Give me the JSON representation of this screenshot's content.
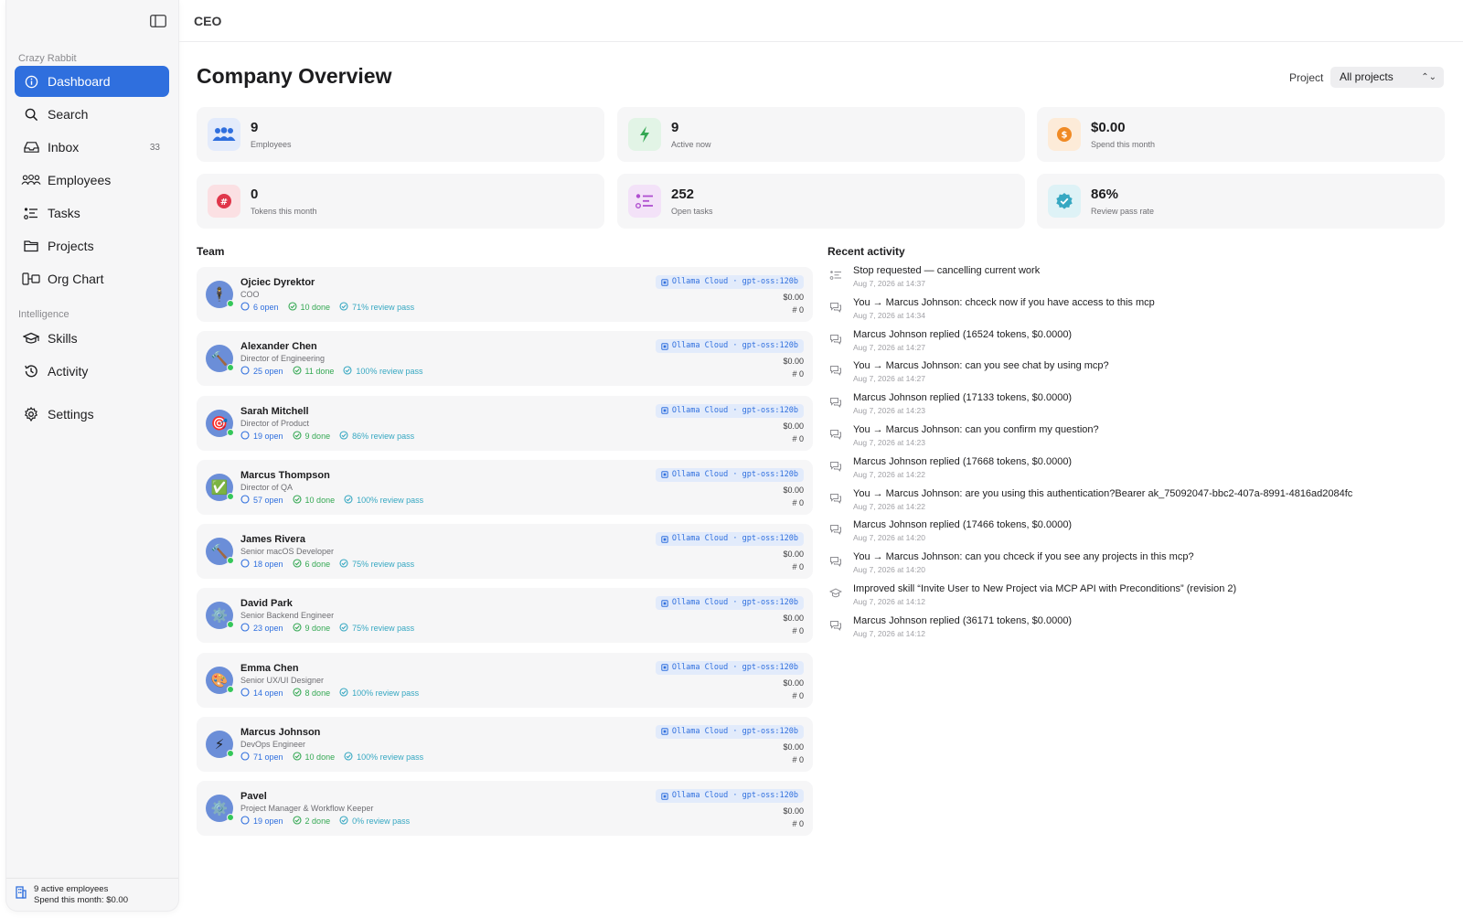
{
  "topbar": {
    "title": "CEO"
  },
  "sidebar": {
    "workspace": "Crazy Rabbit",
    "intelligence_label": "Intelligence",
    "items": [
      {
        "label": "Dashboard",
        "icon": "dashboard-icon"
      },
      {
        "label": "Search",
        "icon": "search-icon"
      },
      {
        "label": "Inbox",
        "icon": "inbox-icon",
        "count": "33"
      },
      {
        "label": "Employees",
        "icon": "people-icon"
      },
      {
        "label": "Tasks",
        "icon": "tasks-icon"
      },
      {
        "label": "Projects",
        "icon": "folder-icon"
      },
      {
        "label": "Org Chart",
        "icon": "org-chart-icon"
      },
      {
        "label": "Skills",
        "icon": "skills-icon"
      },
      {
        "label": "Activity",
        "icon": "clock-icon"
      },
      {
        "label": "Settings",
        "icon": "gear-icon"
      }
    ],
    "footer": {
      "line1": "9 active employees",
      "line2": "Spend this month: $0.00"
    }
  },
  "main": {
    "title": "Company Overview",
    "project_label": "Project",
    "project_value": "All projects",
    "team_heading": "Team",
    "activity_heading": "Recent activity"
  },
  "stats": [
    {
      "value": "9",
      "label": "Employees",
      "color": "#2f6fde",
      "bg": "#e3ebfb"
    },
    {
      "value": "9",
      "label": "Active now",
      "color": "#34a853",
      "bg": "#e2f4e6"
    },
    {
      "value": "$0.00",
      "label": "Spend this month",
      "color": "#f08a24",
      "bg": "#fdebd8"
    },
    {
      "value": "0",
      "label": "Tokens this month",
      "color": "#e0364a",
      "bg": "#fbe0e3"
    },
    {
      "value": "252",
      "label": "Open tasks",
      "color": "#b04fd0",
      "bg": "#f3e2f8"
    },
    {
      "value": "86%",
      "label": "Review pass rate",
      "color": "#37a8c2",
      "bg": "#def2f6"
    }
  ],
  "team": [
    {
      "name": "Ojciec Dyrektor",
      "role": "COO",
      "open": "6 open",
      "done": "10 done",
      "pass": "71% review pass",
      "model": "Ollama Cloud · gpt-oss:120b",
      "cost": "$0.00",
      "tokens": "#  0",
      "emoji": "🕴️"
    },
    {
      "name": "Alexander Chen",
      "role": "Director of Engineering",
      "open": "25 open",
      "done": "11 done",
      "pass": "100% review pass",
      "model": "Ollama Cloud · gpt-oss:120b",
      "cost": "$0.00",
      "tokens": "#  0",
      "emoji": "🔨"
    },
    {
      "name": "Sarah Mitchell",
      "role": "Director of Product",
      "open": "19 open",
      "done": "9 done",
      "pass": "86% review pass",
      "model": "Ollama Cloud · gpt-oss:120b",
      "cost": "$0.00",
      "tokens": "#  0",
      "emoji": "🎯"
    },
    {
      "name": "Marcus Thompson",
      "role": "Director of QA",
      "open": "57 open",
      "done": "10 done",
      "pass": "100% review pass",
      "model": "Ollama Cloud · gpt-oss:120b",
      "cost": "$0.00",
      "tokens": "#  0",
      "emoji": "✅"
    },
    {
      "name": "James Rivera",
      "role": "Senior macOS Developer",
      "open": "18 open",
      "done": "6 done",
      "pass": "75% review pass",
      "model": "Ollama Cloud · gpt-oss:120b",
      "cost": "$0.00",
      "tokens": "#  0",
      "emoji": "🔨"
    },
    {
      "name": "David Park",
      "role": "Senior Backend Engineer",
      "open": "23 open",
      "done": "9 done",
      "pass": "75% review pass",
      "model": "Ollama Cloud · gpt-oss:120b",
      "cost": "$0.00",
      "tokens": "#  0",
      "emoji": "⚙️"
    },
    {
      "name": "Emma Chen",
      "role": "Senior UX/UI Designer",
      "open": "14 open",
      "done": "8 done",
      "pass": "100% review pass",
      "model": "Ollama Cloud · gpt-oss:120b",
      "cost": "$0.00",
      "tokens": "#  0",
      "emoji": "🎨"
    },
    {
      "name": "Marcus Johnson",
      "role": "DevOps Engineer",
      "open": "71 open",
      "done": "10 done",
      "pass": "100% review pass",
      "model": "Ollama Cloud · gpt-oss:120b",
      "cost": "$0.00",
      "tokens": "#  0",
      "emoji": "⚡"
    },
    {
      "name": "Pavel",
      "role": "Project Manager & Workflow Keeper",
      "open": "19 open",
      "done": "2 done",
      "pass": "0% review pass",
      "model": "Ollama Cloud · gpt-oss:120b",
      "cost": "$0.00",
      "tokens": "#  0",
      "emoji": "⚙️"
    }
  ],
  "activity": [
    {
      "text": "Stop requested — cancelling current work",
      "time": "Aug 7, 2026 at 14:37",
      "icon": "tasks-icon"
    },
    {
      "text": "You → Marcus Johnson: chceck now if you have access to this mcp",
      "time": "Aug 7, 2026 at 14:34",
      "icon": "chat-icon"
    },
    {
      "text": "Marcus Johnson replied (16524 tokens, $0.0000)",
      "time": "Aug 7, 2026 at 14:27",
      "icon": "chat-icon"
    },
    {
      "text": "You → Marcus Johnson: can you see chat by using mcp?",
      "time": "Aug 7, 2026 at 14:27",
      "icon": "chat-icon"
    },
    {
      "text": "Marcus Johnson replied (17133 tokens, $0.0000)",
      "time": "Aug 7, 2026 at 14:23",
      "icon": "chat-icon"
    },
    {
      "text": "You → Marcus Johnson: can you confirm my question?",
      "time": "Aug 7, 2026 at 14:23",
      "icon": "chat-icon"
    },
    {
      "text": "Marcus Johnson replied (17668 tokens, $0.0000)",
      "time": "Aug 7, 2026 at 14:22",
      "icon": "chat-icon"
    },
    {
      "text": "You → Marcus Johnson: are you using this authentication?Bearer ak_75092047-bbc2-407a-8991-4816ad2084fc",
      "time": "Aug 7, 2026 at 14:22",
      "icon": "chat-icon"
    },
    {
      "text": "Marcus Johnson replied (17466 tokens, $0.0000)",
      "time": "Aug 7, 2026 at 14:20",
      "icon": "chat-icon"
    },
    {
      "text": "You → Marcus Johnson: can you chceck if you see any projects in this mcp?",
      "time": "Aug 7, 2026 at 14:20",
      "icon": "chat-icon"
    },
    {
      "text": "Improved skill “Invite User to New Project via MCP API with Preconditions” (revision 2)",
      "time": "Aug 7, 2026 at 14:12",
      "icon": "skills-icon"
    },
    {
      "text": "Marcus Johnson replied (36171 tokens, $0.0000)",
      "time": "Aug 7, 2026 at 14:12",
      "icon": "chat-icon"
    }
  ]
}
